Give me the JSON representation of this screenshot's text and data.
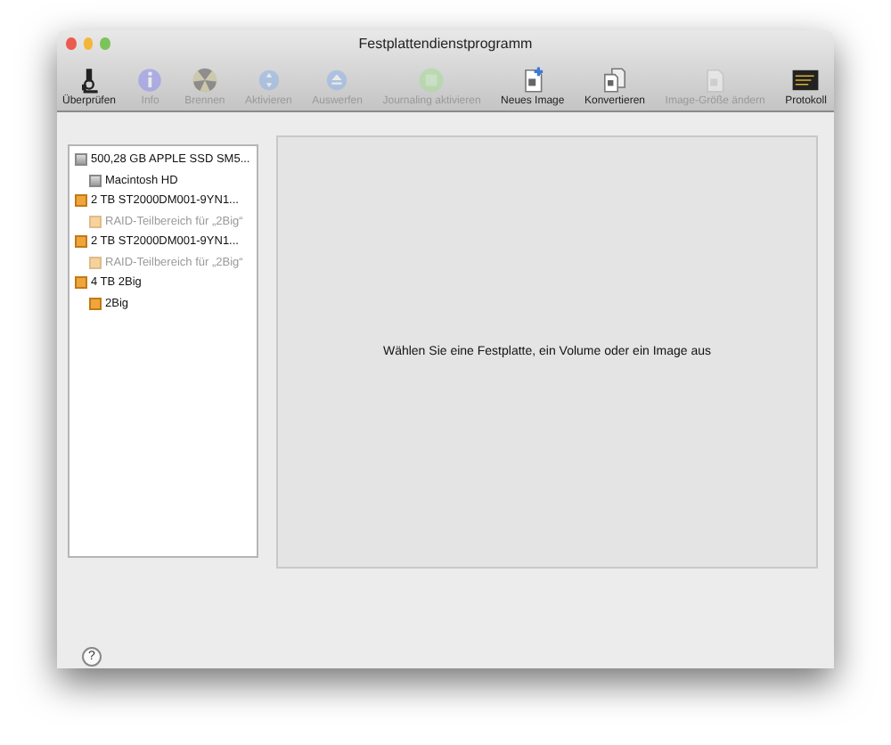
{
  "window": {
    "title": "Festplattendienstprogramm"
  },
  "toolbar": [
    {
      "label": "Überprüfen",
      "kind": "microscope",
      "disabled": false
    },
    {
      "label": "Info",
      "kind": "info",
      "disabled": true
    },
    {
      "label": "Brennen",
      "kind": "burn",
      "disabled": true
    },
    {
      "label": "Aktivieren",
      "kind": "mount",
      "disabled": true
    },
    {
      "label": "Auswerfen",
      "kind": "eject",
      "disabled": true
    },
    {
      "label": "Journaling aktivieren",
      "kind": "journal",
      "disabled": true
    },
    {
      "label": "Neues Image",
      "kind": "newimage",
      "disabled": false
    },
    {
      "label": "Konvertieren",
      "kind": "convert",
      "disabled": false
    },
    {
      "label": "Image-Größe ändern",
      "kind": "resize",
      "disabled": true
    },
    {
      "label": "Protokoll",
      "kind": "log",
      "disabled": false
    }
  ],
  "sidebar": {
    "items": [
      {
        "label": "500,28 GB APPLE SSD SM5...",
        "kind": "internal",
        "disabled": false,
        "children": [
          {
            "label": "Macintosh HD",
            "kind": "internal",
            "disabled": false
          }
        ]
      },
      {
        "label": "2 TB ST2000DM001-9YN1...",
        "kind": "external",
        "disabled": false,
        "children": [
          {
            "label": "RAID-Teilbereich für „2Big“",
            "kind": "external",
            "disabled": true
          }
        ]
      },
      {
        "label": "2 TB ST2000DM001-9YN1...",
        "kind": "external",
        "disabled": false,
        "children": [
          {
            "label": "RAID-Teilbereich für „2Big“",
            "kind": "external",
            "disabled": true
          }
        ]
      },
      {
        "label": "4 TB 2Big",
        "kind": "external",
        "disabled": false,
        "children": [
          {
            "label": "2Big",
            "kind": "external",
            "disabled": false
          }
        ]
      }
    ]
  },
  "main": {
    "message": "Wählen Sie eine Festplatte, ein Volume oder ein Image aus"
  },
  "help_button": {
    "label": "?"
  }
}
